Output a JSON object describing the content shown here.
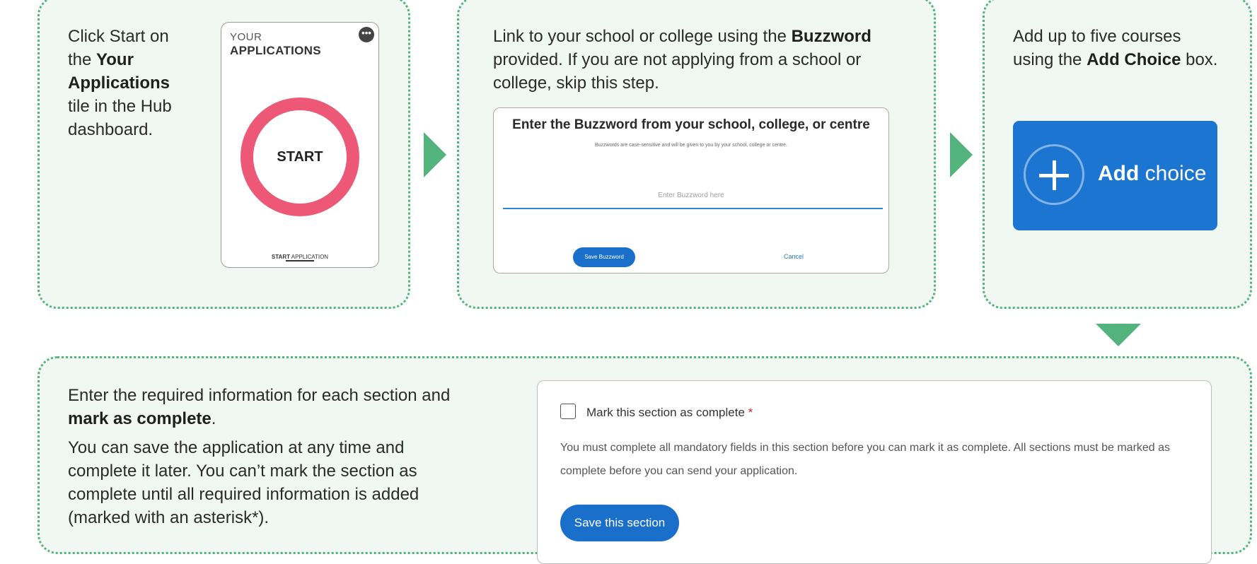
{
  "step1": {
    "text_pre": "Click Start on the ",
    "text_bold": "Your Applications",
    "text_post": " tile in the Hub dashboard.",
    "tile": {
      "small_label": "YOUR",
      "big_label": "APPLICATIONS",
      "menu_glyph": "•••",
      "ring_label": "START",
      "foot_bold": "START",
      "foot_text": " APPLICATION",
      "ring_color": "#ec5876"
    }
  },
  "step2": {
    "text_pre": "Link to your school or college using the ",
    "text_bold": "Buzzword",
    "text_post": " provided. If you are not applying from a school or college, skip this step.",
    "form": {
      "title": "Enter the Buzzword from your school, college, or centre",
      "subtitle": "Buzzwords are case-sensitive and will be given to you by your school, college or centre.",
      "placeholder": "Enter Buzzword here",
      "save_label": "Save Buzzword",
      "cancel_label": "Cancel"
    }
  },
  "step3": {
    "text_pre": "Add up to five courses using the ",
    "text_bold": "Add Choice",
    "text_post": " box.",
    "button": {
      "bold": "Add",
      "rest": " choice",
      "color": "#1c76d1"
    }
  },
  "step4": {
    "p1_pre": "Enter the required information for each section and ",
    "p1_bold": "mark as complete",
    "p1_post": ".",
    "p2": "You can save the application at any time and complete it later. You can’t mark the section as complete until all required information is added (marked with an asterisk*).",
    "card": {
      "checkbox_label": "Mark this section as complete",
      "required_star": "*",
      "note": "You must complete all mandatory fields in this section before you can mark it as complete. All sections must be marked as complete before you can send your application.",
      "save_label": "Save this section"
    }
  },
  "icons": [
    "arrow-right-icon",
    "arrow-right-icon",
    "arrow-down-icon",
    "plus-icon",
    "more-icon",
    "checkbox-icon"
  ],
  "colors": {
    "panel_border": "#52b47c",
    "panel_bg": "#f1f7f2",
    "primary_blue": "#1a6fcb"
  }
}
